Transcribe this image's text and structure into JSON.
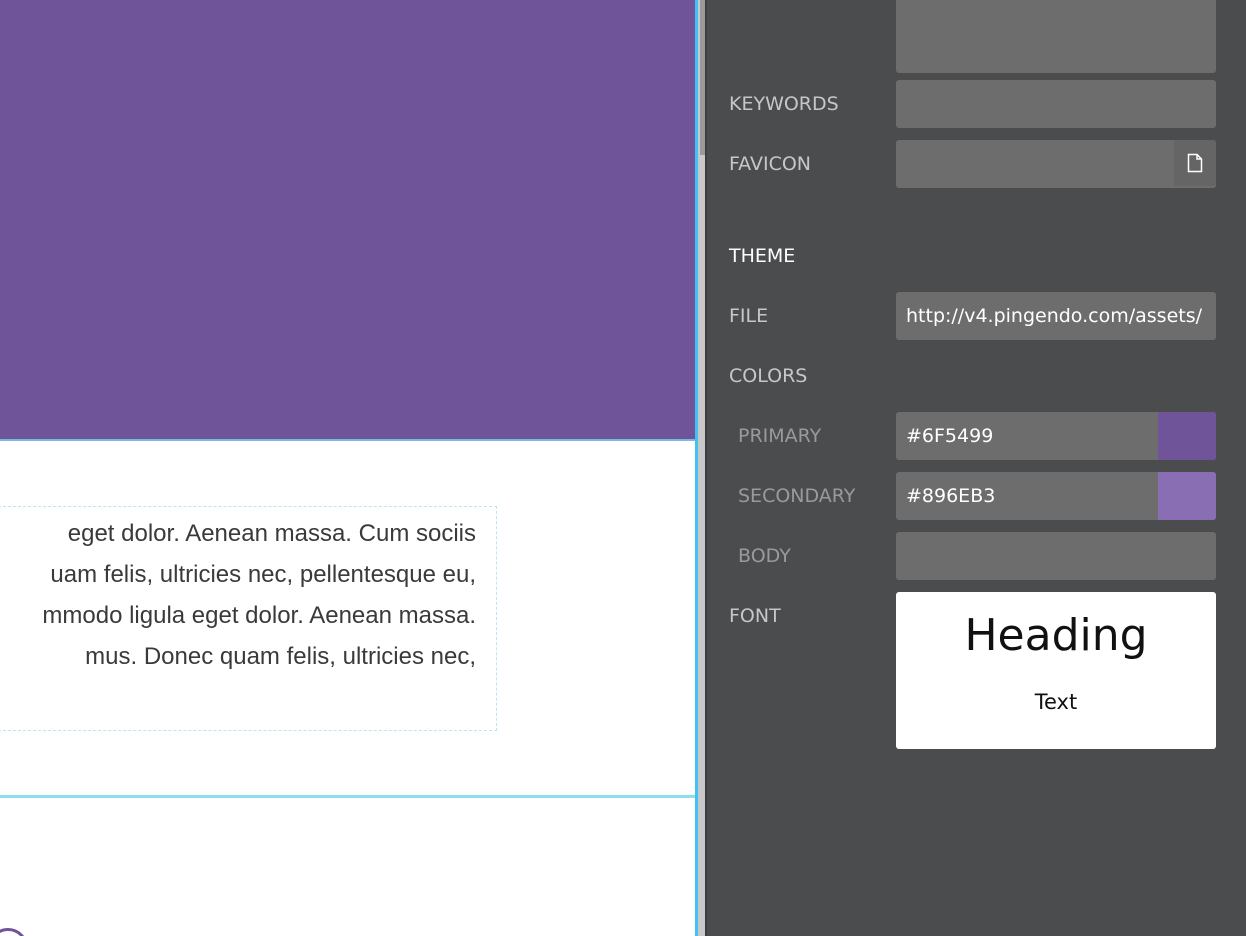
{
  "canvas": {
    "paragraph_lines": [
      "eget dolor. Aenean massa. Cum sociis",
      "uam felis, ultricies nec, pellentesque eu,",
      "mmodo ligula eget dolor. Aenean massa.",
      " mus. Donec quam felis, ultricies nec,"
    ]
  },
  "panel": {
    "keywords": {
      "label": "KEYWORDS",
      "value": ""
    },
    "favicon": {
      "label": "FAVICON",
      "value": "",
      "icon": "file-icon"
    },
    "theme": {
      "section_label": "THEME",
      "file": {
        "label": "FILE",
        "value": "http://v4.pingendo.com/assets/"
      },
      "colors_label": "COLORS",
      "primary": {
        "label": "PRIMARY",
        "value": "#6F5499",
        "color": "#6f5499"
      },
      "secondary": {
        "label": "SECONDARY",
        "value": "#896EB3",
        "color": "#896eb3"
      },
      "body": {
        "label": "BODY",
        "value": ""
      },
      "font": {
        "label": "FONT",
        "preview_heading": "Heading",
        "preview_text": "Text"
      }
    }
  }
}
